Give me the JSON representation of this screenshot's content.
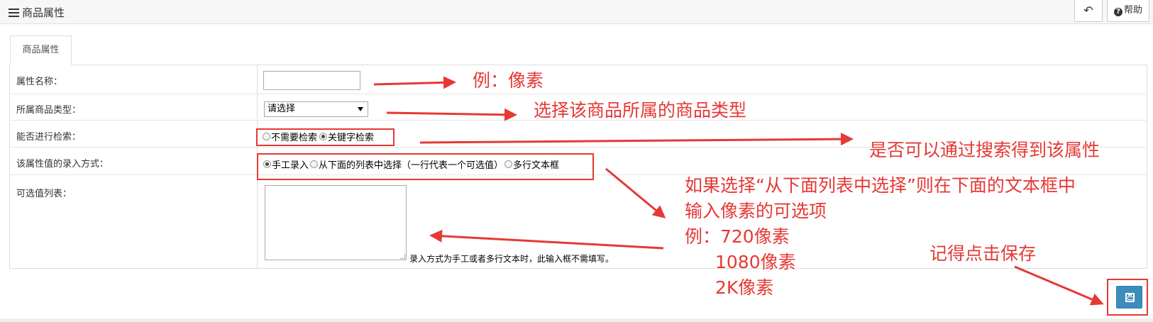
{
  "header": {
    "title": "商品属性",
    "title_icon": "list-icon",
    "back_icon": "↶",
    "help_label": "帮助"
  },
  "tab": {
    "label": "商品属性"
  },
  "form": {
    "name_label": "属性名称：",
    "name_value": "",
    "type_label": "所属商品类型：",
    "type_selected": "请选择",
    "search_label": "能否进行检索：",
    "search_options": [
      "不需要检索",
      "关键字检索"
    ],
    "search_selected": "关键字检索",
    "input_mode_label": "该属性值的录入方式：",
    "input_mode_options": [
      "手工录入",
      "从下面的列表中选择（一行代表一个可选值）",
      "多行文本框"
    ],
    "input_mode_selected": "手工录入",
    "values_label": "可选值列表：",
    "values_text": "",
    "values_hint": "录入方式为手工或者多行文本时，此输入框不需填写。"
  },
  "annotations": {
    "name": "例：像素",
    "type": "选择该商品所属的商品类型",
    "search": "是否可以通过搜索得到该属性",
    "list_line1": "如果选择“从下面列表中选择”则在下面的文本框中",
    "list_line2": "输入像素的可选项",
    "list_line3": "例：720像素",
    "list_line4": "1080像素",
    "list_line5": "2K像素",
    "save": "记得点击保存"
  },
  "colors": {
    "annotation": "#e53935",
    "save_button": "#3c8dbc"
  },
  "save_icon": "floppy-disk-icon"
}
